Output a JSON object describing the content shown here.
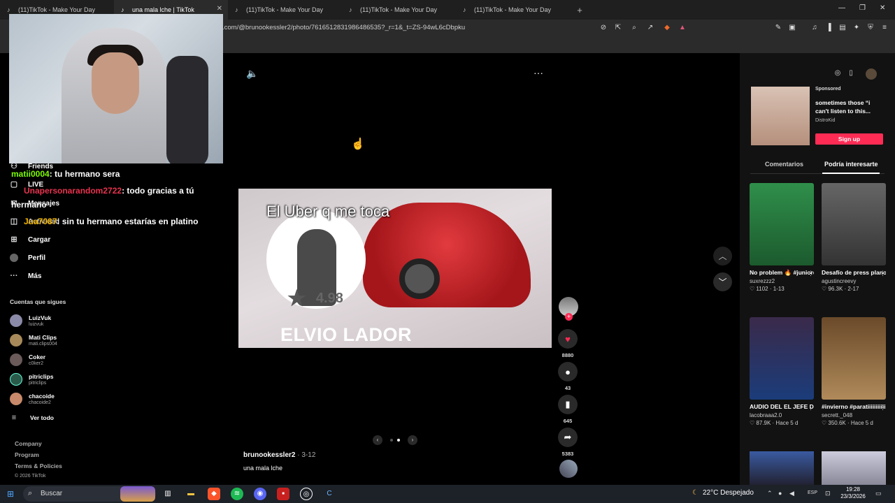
{
  "browser": {
    "tabs": [
      {
        "title": "(11)TikTok - Make Your Day",
        "active": false
      },
      {
        "title": "una mala lche | TikTok",
        "active": true
      },
      {
        "title": "(11)TikTok - Make Your Day",
        "active": false
      },
      {
        "title": "(11)TikTok - Make Your Day",
        "active": false
      },
      {
        "title": "(11)TikTok - Make Your Day",
        "active": false
      }
    ],
    "url": ".com/@brunookessler2/photo/7616512831986486535?_r=1&_t=ZS-94wL6cDbpku"
  },
  "sidebar": {
    "items": [
      {
        "label": "Friends",
        "icon": "friends-icon"
      },
      {
        "label": "LIVE",
        "icon": "live-icon"
      },
      {
        "label": "Mensajes",
        "icon": "messages-icon"
      },
      {
        "label": "Actividad",
        "icon": "activity-icon"
      },
      {
        "label": "Cargar",
        "icon": "upload-icon"
      },
      {
        "label": "Perfil",
        "icon": "profile-icon"
      },
      {
        "label": "Más",
        "icon": "more-icon"
      }
    ],
    "following_title": "Cuentas que sigues",
    "accounts": [
      {
        "name": "LuizVuk",
        "handle": "luizvuk"
      },
      {
        "name": "Mati Clips",
        "handle": "mati.clips004"
      },
      {
        "name": "Coker",
        "handle": "c0ker2"
      },
      {
        "name": "pitriclips",
        "handle": "pitriclips"
      },
      {
        "name": "chacoide",
        "handle": "chacoide2"
      }
    ],
    "see_all": "Ver todo",
    "footer": [
      "Company",
      "Program",
      "Terms & Policies",
      "© 2026 TikTok"
    ]
  },
  "chat": [
    {
      "user": "matii0004",
      "text": ": tu hermano sera"
    },
    {
      "user": "Unapersonarandom2722",
      "text": ": todo gracias a tú"
    },
    {
      "user": "",
      "text": "hermano"
    },
    {
      "user": "Jua7087",
      "text": ": sin tu hermano estarías en platino"
    }
  ],
  "video": {
    "caption": "El Uber q me toca",
    "rating": "4.98",
    "driver_name": "ELVIO LADOR",
    "author": "brunookessler2",
    "date": "· 3-12",
    "description": "una mala lche"
  },
  "actions": {
    "likes": "8880",
    "comments": "43",
    "saves": "645",
    "shares": "5383"
  },
  "ad": {
    "sponsored": "Sponsored",
    "text": "sometimes those “i can't listen to this...",
    "brand": "DistroKid",
    "cta": "Sign up"
  },
  "right_tabs": [
    "Comentarios",
    "Podría interesarte"
  ],
  "cards": [
    {
      "title": "No problem 🔥 #juniordebarran...",
      "user": "suxrezzz2",
      "stats": "♡ 1102 · 1-13",
      "color": "#1c7a3a"
    },
    {
      "title": "Desafío de press plano por la...",
      "user": "agustincreevy",
      "stats": "♡ 96.3K · 2-17",
      "color": "#4a4a4a"
    },
    {
      "title": "AUDIO DEL EL JEFE DE LA BAR...",
      "user": "lacobraaa2.0",
      "stats": "♡ 87.9K · Hace 5 d",
      "color": "#1b3c7a"
    },
    {
      "title": "#invierno #paratiiiiiiiiiiiiiiii...",
      "user": "secrett._048",
      "stats": "♡ 350.6K · Hace 5 d",
      "color": "#5a3c22"
    }
  ],
  "taskbar": {
    "search": "Buscar",
    "weather": "22°C  Despejado",
    "lang": "ESP",
    "time": "19:28",
    "date": "23/3/2026"
  }
}
